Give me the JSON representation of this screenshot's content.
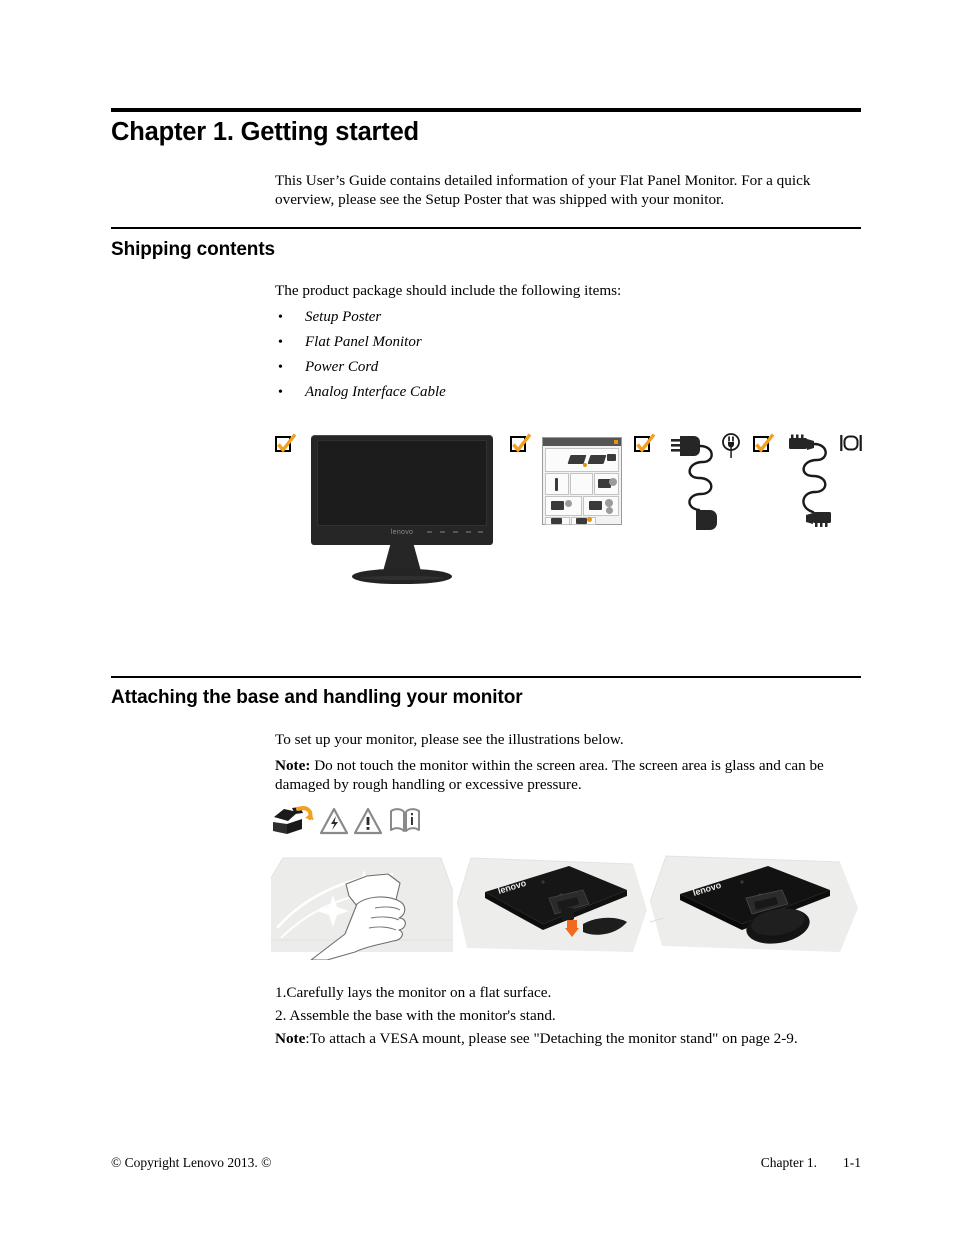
{
  "document": {
    "chapter_title": "Chapter 1. Getting started",
    "intro_paragraph": "This User’s Guide contains detailed information of your Flat Panel Monitor.  For a quick overview, please see the Setup Poster that was shipped with your monitor."
  },
  "shipping_section": {
    "heading": "Shipping contents",
    "lead_in": "The product package should include the following items:",
    "items": [
      {
        "label": "Setup Poster"
      },
      {
        "label": "Flat Panel Monitor"
      },
      {
        "label": "Power Cord"
      },
      {
        "label": "Analog Interface Cable"
      }
    ],
    "illustration": {
      "monitor_brand": "lenovo",
      "checkbox_count": 4,
      "check_color": "#F2A01E",
      "icons": [
        "check-box-icon",
        "flat-panel-monitor-illustration",
        "check-box-icon",
        "setup-poster-thumbnail",
        "check-box-icon",
        "power-cord-illustration",
        "power-outlet-icon",
        "check-box-icon",
        "analog-interface-cable-illustration",
        "monitor-port-icon"
      ]
    }
  },
  "attaching_section": {
    "heading": "Attaching the base and handling your monitor",
    "intro": "To set up your monitor, please see the illustrations below.",
    "note_label": "Note:",
    "note_body": " Do not touch the monitor within the screen area. The screen area is glass and can be damaged by rough handling or excessive pressure.",
    "warning_icons": [
      "unpacking-box-icon",
      "electrical-hazard-icon",
      "general-warning-icon",
      "read-manual-icon"
    ],
    "panels": [
      {
        "name": "cleaning-screen-illustration"
      },
      {
        "name": "attach-base-illustration"
      },
      {
        "name": "base-attached-illustration"
      }
    ],
    "steps": [
      "1.Carefully lays the monitor on a flat surface.",
      "2. Assemble the base with the monitor's stand."
    ],
    "vesa_note_label": "Note",
    "vesa_note_body": ":To attach a VESA mount, please see \"Detaching the monitor stand\" on page 2-9."
  },
  "footer": {
    "copyright": "© Copyright Lenovo 2013. ©",
    "chapter": "Chapter 1.",
    "page_number": "1-1"
  },
  "colors": {
    "accent_orange": "#F2A01E",
    "rule_black": "#000000",
    "monitor_dark": "#262626"
  }
}
